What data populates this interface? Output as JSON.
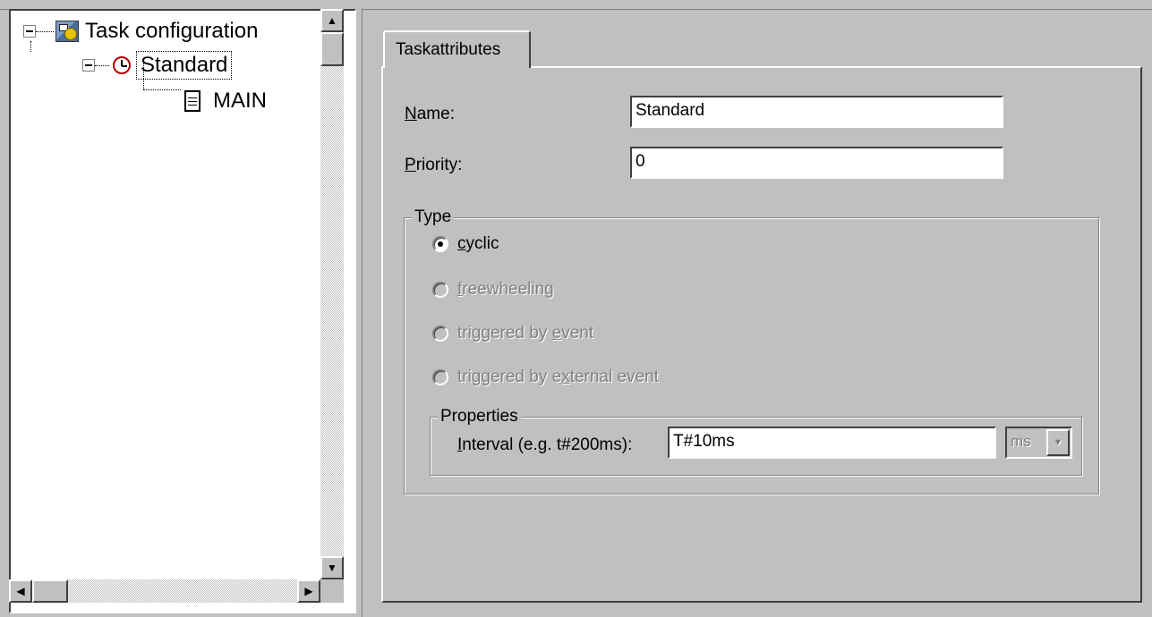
{
  "tree": {
    "root": {
      "label": "Task configuration",
      "icon": "task-config-icon"
    },
    "task": {
      "label": "Standard",
      "icon": "clock-icon"
    },
    "program": {
      "label": "MAIN",
      "icon": "document-icon"
    }
  },
  "tabs": [
    {
      "label": "Taskattributes"
    }
  ],
  "form": {
    "name": {
      "label_accel": "N",
      "label_rest": "ame:",
      "value": "Standard"
    },
    "priority": {
      "label_accel": "P",
      "label_rest": "riority:",
      "value": "0"
    }
  },
  "type_group": {
    "title": "Type",
    "options": [
      {
        "accel": "c",
        "rest": "yclic",
        "prefix": "",
        "selected": true,
        "enabled": true
      },
      {
        "accel": "f",
        "rest": "reewheeling",
        "prefix": "",
        "selected": false,
        "enabled": false
      },
      {
        "prefix": "triggered by ",
        "accel": "e",
        "rest": "vent",
        "selected": false,
        "enabled": false
      },
      {
        "prefix": "triggered by e",
        "accel": "x",
        "rest": "ternal event",
        "selected": false,
        "enabled": false
      }
    ]
  },
  "properties_group": {
    "title": "Properties",
    "interval": {
      "label_accel": "I",
      "label_rest": "nterval (e.g. t#200ms):",
      "value": "T#10ms",
      "unit": "ms"
    }
  },
  "colors": {
    "background": "#c0c0c0",
    "field": "#ffffff",
    "disabled_text": "#808080"
  }
}
